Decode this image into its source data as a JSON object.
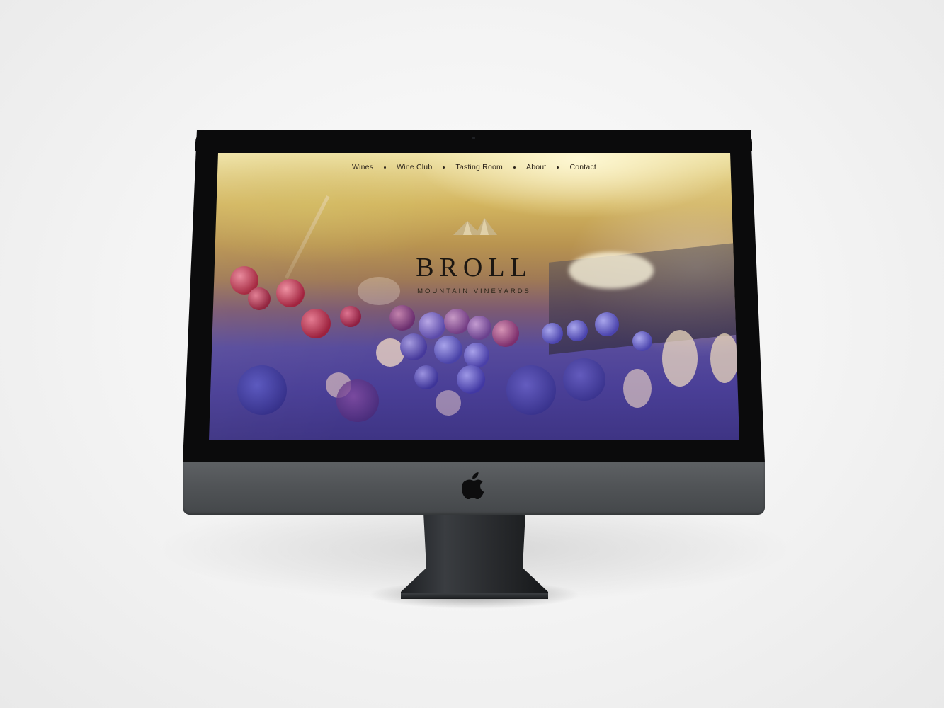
{
  "page": {
    "background_color": "#f3f3f3"
  },
  "device": {
    "type": "desktop-monitor",
    "bezel_color": "#0b0b0c",
    "chin_color": "#515457",
    "logo_icon": "apple-icon"
  },
  "website": {
    "nav": {
      "items": [
        {
          "label": "Wines"
        },
        {
          "label": "Wine Club"
        },
        {
          "label": "Tasting Room"
        },
        {
          "label": "About"
        },
        {
          "label": "Contact"
        }
      ],
      "separator_icon": "bullet-dot-icon"
    },
    "hero": {
      "logo_icon": "mountain-peaks-icon",
      "brand_name": "BROLL",
      "brand_subtitle": "MOUNTAIN VINEYARDS",
      "background": "grapes-photo",
      "logo_color": "#c8b58a",
      "text_color": "#1c1712"
    }
  }
}
